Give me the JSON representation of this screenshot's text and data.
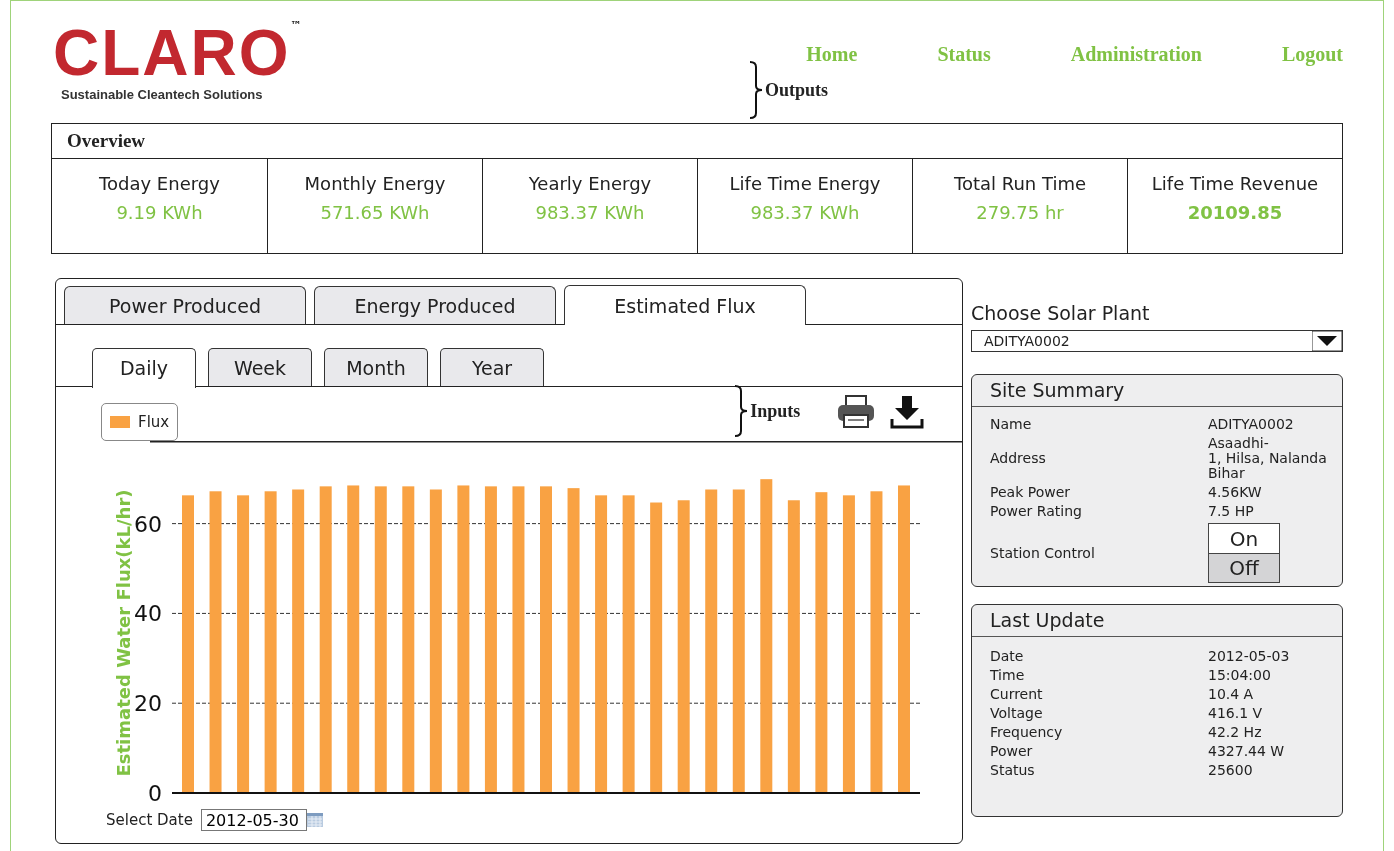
{
  "logo": {
    "name": "CLARO",
    "tm": "™",
    "tagline": "Sustainable Cleantech Solutions"
  },
  "nav": [
    {
      "label": "Home"
    },
    {
      "label": "Status"
    },
    {
      "label": "Administration"
    },
    {
      "label": "Logout"
    }
  ],
  "outputs_note": "Outputs",
  "overview": {
    "title": "Overview",
    "metrics": [
      {
        "label": "Today Energy",
        "value": "9.19 KWh",
        "emphasis": false
      },
      {
        "label": "Monthly Energy",
        "value": "571.65 KWh",
        "emphasis": false
      },
      {
        "label": "Yearly Energy",
        "value": "983.37 KWh",
        "emphasis": false
      },
      {
        "label": "Life Time Energy",
        "value": "983.37 KWh",
        "emphasis": false
      },
      {
        "label": "Total Run Time",
        "value": "279.75 hr",
        "emphasis": false
      },
      {
        "label": "Life Time Revenue",
        "value": "20109.85",
        "emphasis": true
      }
    ]
  },
  "tabs": [
    {
      "label": "Power Produced",
      "selected": false
    },
    {
      "label": "Energy Produced",
      "selected": false
    },
    {
      "label": "Estimated Flux",
      "selected": true
    }
  ],
  "period_tabs": [
    {
      "label": "Daily",
      "selected": true
    },
    {
      "label": "Week",
      "selected": false
    },
    {
      "label": "Month",
      "selected": false
    },
    {
      "label": "Year",
      "selected": false
    }
  ],
  "inputs_note": "Inputs",
  "chart_data": {
    "type": "bar",
    "ylabel": "Estimated Water Flux(kL/hr)",
    "grid": true,
    "ylim": [
      0,
      78.4
    ],
    "yticks": [
      0,
      20,
      40,
      60
    ],
    "series": [
      {
        "name": "Flux",
        "color": "#f9a243",
        "values": [
          66.3,
          67.2,
          66.3,
          67.2,
          67.6,
          68.3,
          68.5,
          68.3,
          68.3,
          67.6,
          68.5,
          68.3,
          68.3,
          68.3,
          67.9,
          66.3,
          66.3,
          64.7,
          65.2,
          67.6,
          67.6,
          69.9,
          65.2,
          67.0,
          66.3,
          67.2,
          68.5
        ]
      }
    ]
  },
  "select_date": {
    "label": "Select Date",
    "value": "2012-05-30"
  },
  "plant": {
    "label": "Choose Solar Plant",
    "value": "ADITYA0002"
  },
  "site_summary": {
    "title": "Site Summary",
    "rows": [
      {
        "label": "Name",
        "value": "ADITYA0002"
      },
      {
        "label": "Address",
        "value": "Asaadhi-\n1, Hilsa, Nalanda\nBihar"
      },
      {
        "label": "Peak Power",
        "value": "4.56KW"
      },
      {
        "label": "Power Rating",
        "value": "7.5 HP"
      }
    ],
    "station_control": {
      "label": "Station Control",
      "options": [
        {
          "label": "On",
          "selected": false
        },
        {
          "label": "Off",
          "selected": true
        }
      ]
    }
  },
  "last_update": {
    "title": "Last Update",
    "rows": [
      {
        "label": "Date",
        "value": "2012-05-03"
      },
      {
        "label": "Time",
        "value": "15:04:00"
      },
      {
        "label": "Current",
        "value": "10.4 A"
      },
      {
        "label": "Voltage",
        "value": "416.1 V"
      },
      {
        "label": "Frequency",
        "value": "42.2 Hz"
      },
      {
        "label": "Power",
        "value": "4327.44 W"
      },
      {
        "label": "Status",
        "value": "25600"
      }
    ]
  }
}
